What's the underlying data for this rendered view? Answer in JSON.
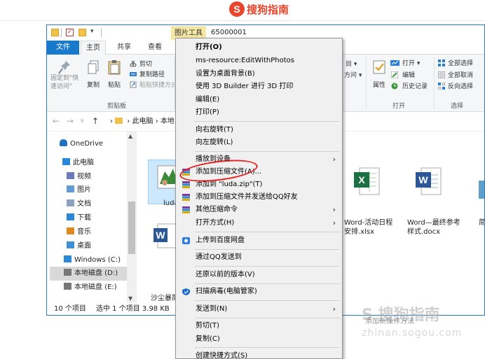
{
  "header": {
    "logo_mark": "S",
    "logo_text": "搜狗指南"
  },
  "window": {
    "tools_tab": "图片工具",
    "title": "65000001",
    "quick_access_dropdown": "▾"
  },
  "tabs": [
    "文件",
    "主页",
    "共享",
    "查看"
  ],
  "ribbon": {
    "pin_label": "固定到\"快速访问\"",
    "copy_label": "复制",
    "paste_label": "粘贴",
    "cut_label": "剪切",
    "copy_path_label": "复制路径",
    "paste_shortcut_label": "粘贴快捷方式",
    "clipboard_group": "剪贴板",
    "select_item_fragment": "目 ▾",
    "item_fragment": "方问 ▾",
    "properties_label": "属性",
    "open_label": "打开 ▾",
    "edit_label": "编辑",
    "history_label": "历史记录",
    "open_group": "打开",
    "select_all": "全部选择",
    "select_none": "全部取消",
    "invert_selection": "反向选择",
    "select_group": "选择"
  },
  "nav": {
    "back": "←",
    "forward": "→",
    "recent": "∨",
    "up": "↑",
    "breadcrumb_sep": "›",
    "path_root": "此电脑",
    "path_current": "本地"
  },
  "sidebar": {
    "items": [
      {
        "label": "OneDrive",
        "color": "#1e73be"
      },
      {
        "label": "此电脑",
        "color": "#2b88d8"
      },
      {
        "label": "视频",
        "color": "#6a7bb8"
      },
      {
        "label": "图片",
        "color": "#5f9bd6"
      },
      {
        "label": "文档",
        "color": "#8aa1c0"
      },
      {
        "label": "下载",
        "color": "#2b88d8"
      },
      {
        "label": "音乐",
        "color": "#e08a1e"
      },
      {
        "label": "桌面",
        "color": "#3b8fd6"
      },
      {
        "label": "Windows (C:)",
        "color": "#2b88d8"
      },
      {
        "label": "本地磁盘 (D:)",
        "color": "#777777"
      },
      {
        "label": "本地磁盘 (E:)",
        "color": "#777777"
      }
    ]
  },
  "content": {
    "files": [
      {
        "label": "luda"
      },
      {
        "label": "沙尘暴简"
      },
      {
        "label": "Word-活动日程\n安排.xlsx"
      },
      {
        "label": "Word—最终参考\n样式.docx"
      },
      {
        "label": "简"
      }
    ]
  },
  "status": {
    "count": "10 个项目",
    "selected": "选中 1 个项目  3.98 KB"
  },
  "menu": {
    "items": [
      {
        "label": "打开(O)",
        "bold": true
      },
      {
        "label": "ms-resource:EditWithPhotos"
      },
      {
        "label": "设置为桌面背景(B)"
      },
      {
        "label": "使用 3D Builder 进行 3D 打印"
      },
      {
        "label": "编辑(E)"
      },
      {
        "label": "打印(P)"
      },
      {
        "label": "向右旋转(T)"
      },
      {
        "label": "向左旋转(L)"
      },
      {
        "label": "播放到设备"
      },
      {
        "label": "添加到压缩文件(A)..."
      },
      {
        "label": "添加到 \"luda.zip\"(T)"
      },
      {
        "label": "添加到压缩文件并发送给QQ好友"
      },
      {
        "label": "其他压缩命令"
      },
      {
        "label": "打开方式(H)"
      },
      {
        "label": "上传到百度网盘"
      },
      {
        "label": "通过QQ发送到"
      },
      {
        "label": "还原以前的版本(V)"
      },
      {
        "label": "扫描病毒(电脑管家)"
      },
      {
        "label": "发送到(N)"
      },
      {
        "label": "剪切(T)"
      },
      {
        "label": "复制(C)"
      },
      {
        "label": "创建快捷方式(S)"
      }
    ],
    "submenu_arrow": "›"
  },
  "watermark": {
    "logo": "S 搜狗指南",
    "caption": "添加新操作方法",
    "url": "zhinan.sogou.com"
  },
  "colors": {
    "file_tab": "#1979ca",
    "tools_tab": "#f5e7a4",
    "menu_bg": "#f0f0f0",
    "highlight_ring": "#e62020",
    "brand": "#e8452c"
  }
}
